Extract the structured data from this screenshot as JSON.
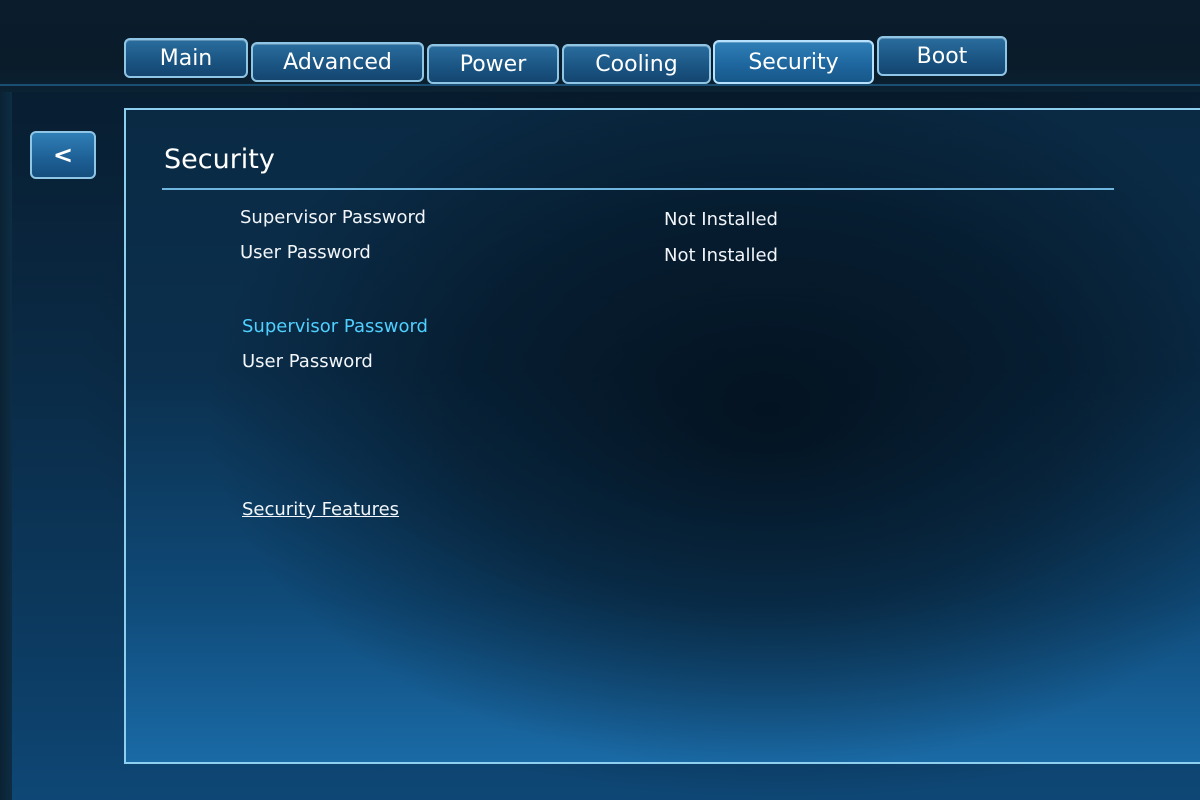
{
  "tabs": [
    {
      "label": "Main",
      "active": false
    },
    {
      "label": "Advanced",
      "active": false
    },
    {
      "label": "Power",
      "active": false
    },
    {
      "label": "Cooling",
      "active": false
    },
    {
      "label": "Security",
      "active": true
    },
    {
      "label": "Boot",
      "active": false
    }
  ],
  "back_button": {
    "label": "<"
  },
  "panel": {
    "title": "Security",
    "status": [
      {
        "label": "Supervisor Password",
        "value": "Not Installed"
      },
      {
        "label": "User Password",
        "value": "Not Installed"
      }
    ],
    "settings": [
      {
        "label": "Supervisor Password",
        "highlighted": true
      },
      {
        "label": "User Password",
        "highlighted": false
      }
    ],
    "link": {
      "label": "Security Features"
    }
  },
  "colors": {
    "accent": "#4fd0ff",
    "panel_border": "#8ecff0",
    "tab_fill": "#1b5684"
  }
}
